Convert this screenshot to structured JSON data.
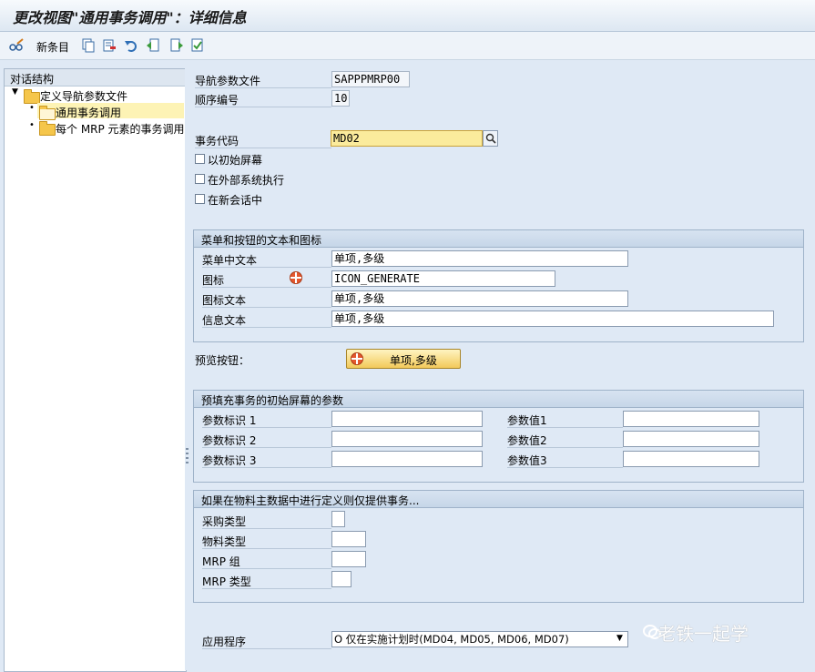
{
  "window": {
    "title": "更改视图\"通用事务调用\"：详细信息"
  },
  "toolbar": {
    "new_entries_label": "新条目",
    "icons": [
      "glasses-pen-icon",
      "copy-icon",
      "delete-icon",
      "undo-icon",
      "prev-entry-icon",
      "next-entry-icon",
      "select-all-icon"
    ]
  },
  "dialog_structure": {
    "header": "对话结构",
    "items": [
      {
        "label": "定义导航参数文件",
        "level": 0
      },
      {
        "label": "通用事务调用",
        "level": 1,
        "selected": true
      },
      {
        "label": "每个 MRP 元素的事务调用",
        "level": 1
      }
    ]
  },
  "fields": {
    "nav_profile": {
      "label": "导航参数文件",
      "value": "SAPPPMRP00"
    },
    "sequence": {
      "label": "顺序编号",
      "value": "10"
    },
    "tcode": {
      "label": "事务代码",
      "value": "MD02"
    }
  },
  "checkboxes": [
    {
      "label": "以初始屏幕",
      "checked": false
    },
    {
      "label": "在外部系统执行",
      "checked": false
    },
    {
      "label": "在新会话中",
      "checked": false
    }
  ],
  "menu_group": {
    "title": "菜单和按钮的文本和图标",
    "rows": [
      {
        "label": "菜单中文本",
        "value": "单项,多级"
      },
      {
        "label": "图标",
        "value": "ICON_GENERATE"
      },
      {
        "label": "图标文本",
        "value": "单项,多级"
      },
      {
        "label": "信息文本",
        "value": "单项,多级"
      }
    ]
  },
  "preview": {
    "label": "预览按钮：",
    "button_label": "单项,多级"
  },
  "params_group": {
    "title": "预填充事务的初始屏幕的参数",
    "ids": [
      "参数标识 1",
      "参数标识 2",
      "参数标识 3"
    ],
    "values": [
      "参数值1",
      "参数值2",
      "参数值3"
    ]
  },
  "restrict_group": {
    "title": "如果在物料主数据中进行定义则仅提供事务...",
    "rows": [
      "采购类型",
      "物料类型",
      "MRP 组",
      "MRP 类型"
    ]
  },
  "application": {
    "label": "应用程序",
    "value": "O 仅在实施计划时(MD04, MD05, MD06, MD07)"
  },
  "watermark": "老铁一起学",
  "colors": {
    "selected_item_bg": "#fdf3b5",
    "required_field_bg": "#fbeb9c",
    "window_bg": "#dfe9f5"
  }
}
